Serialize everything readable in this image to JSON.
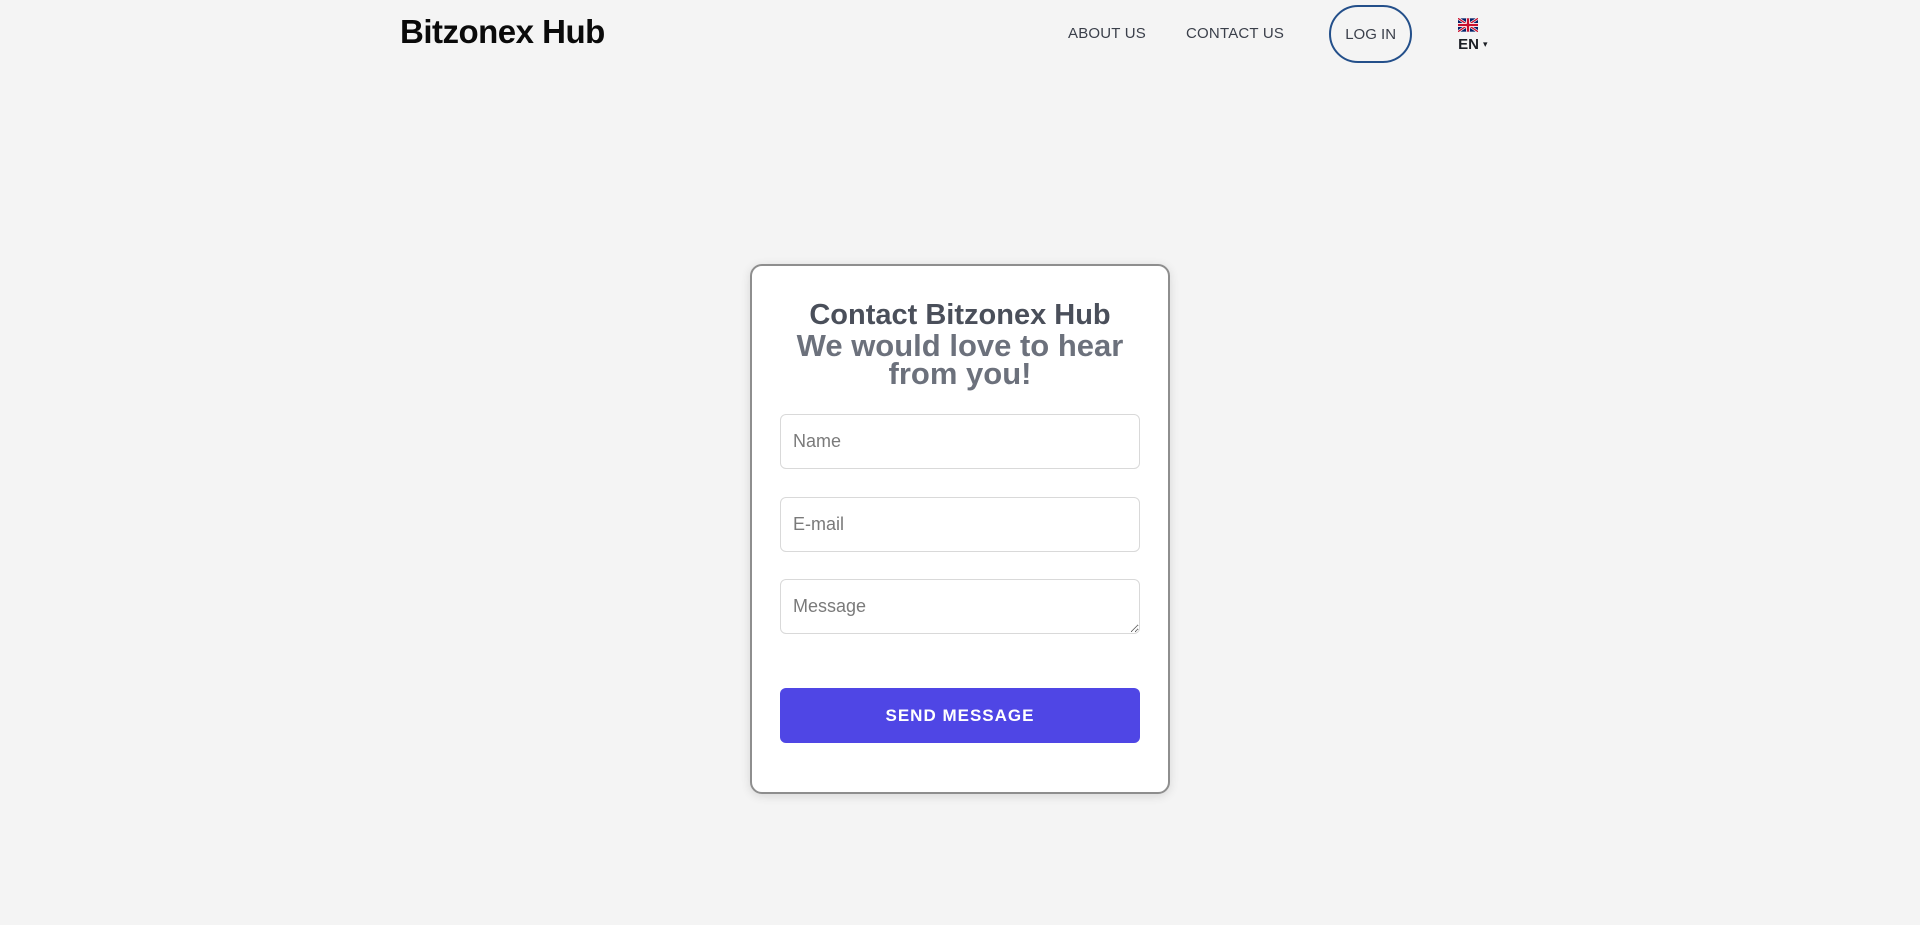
{
  "header": {
    "brand": "Bitzonex Hub",
    "nav": {
      "about": "ABOUT US",
      "contact": "CONTACT US",
      "login": "LOG IN"
    },
    "language": {
      "code": "EN",
      "flag_icon": "uk-flag-icon",
      "caret": "▾"
    }
  },
  "contact_form": {
    "title": "Contact Bitzonex Hub",
    "subtitle": "We would love to hear from you!",
    "name_placeholder": "Name",
    "email_placeholder": "E-mail",
    "message_placeholder": "Message",
    "submit_label": "SEND MESSAGE"
  },
  "colors": {
    "accent": "#4f46e5",
    "login_border": "#234f8a",
    "background": "#f4f4f4"
  }
}
